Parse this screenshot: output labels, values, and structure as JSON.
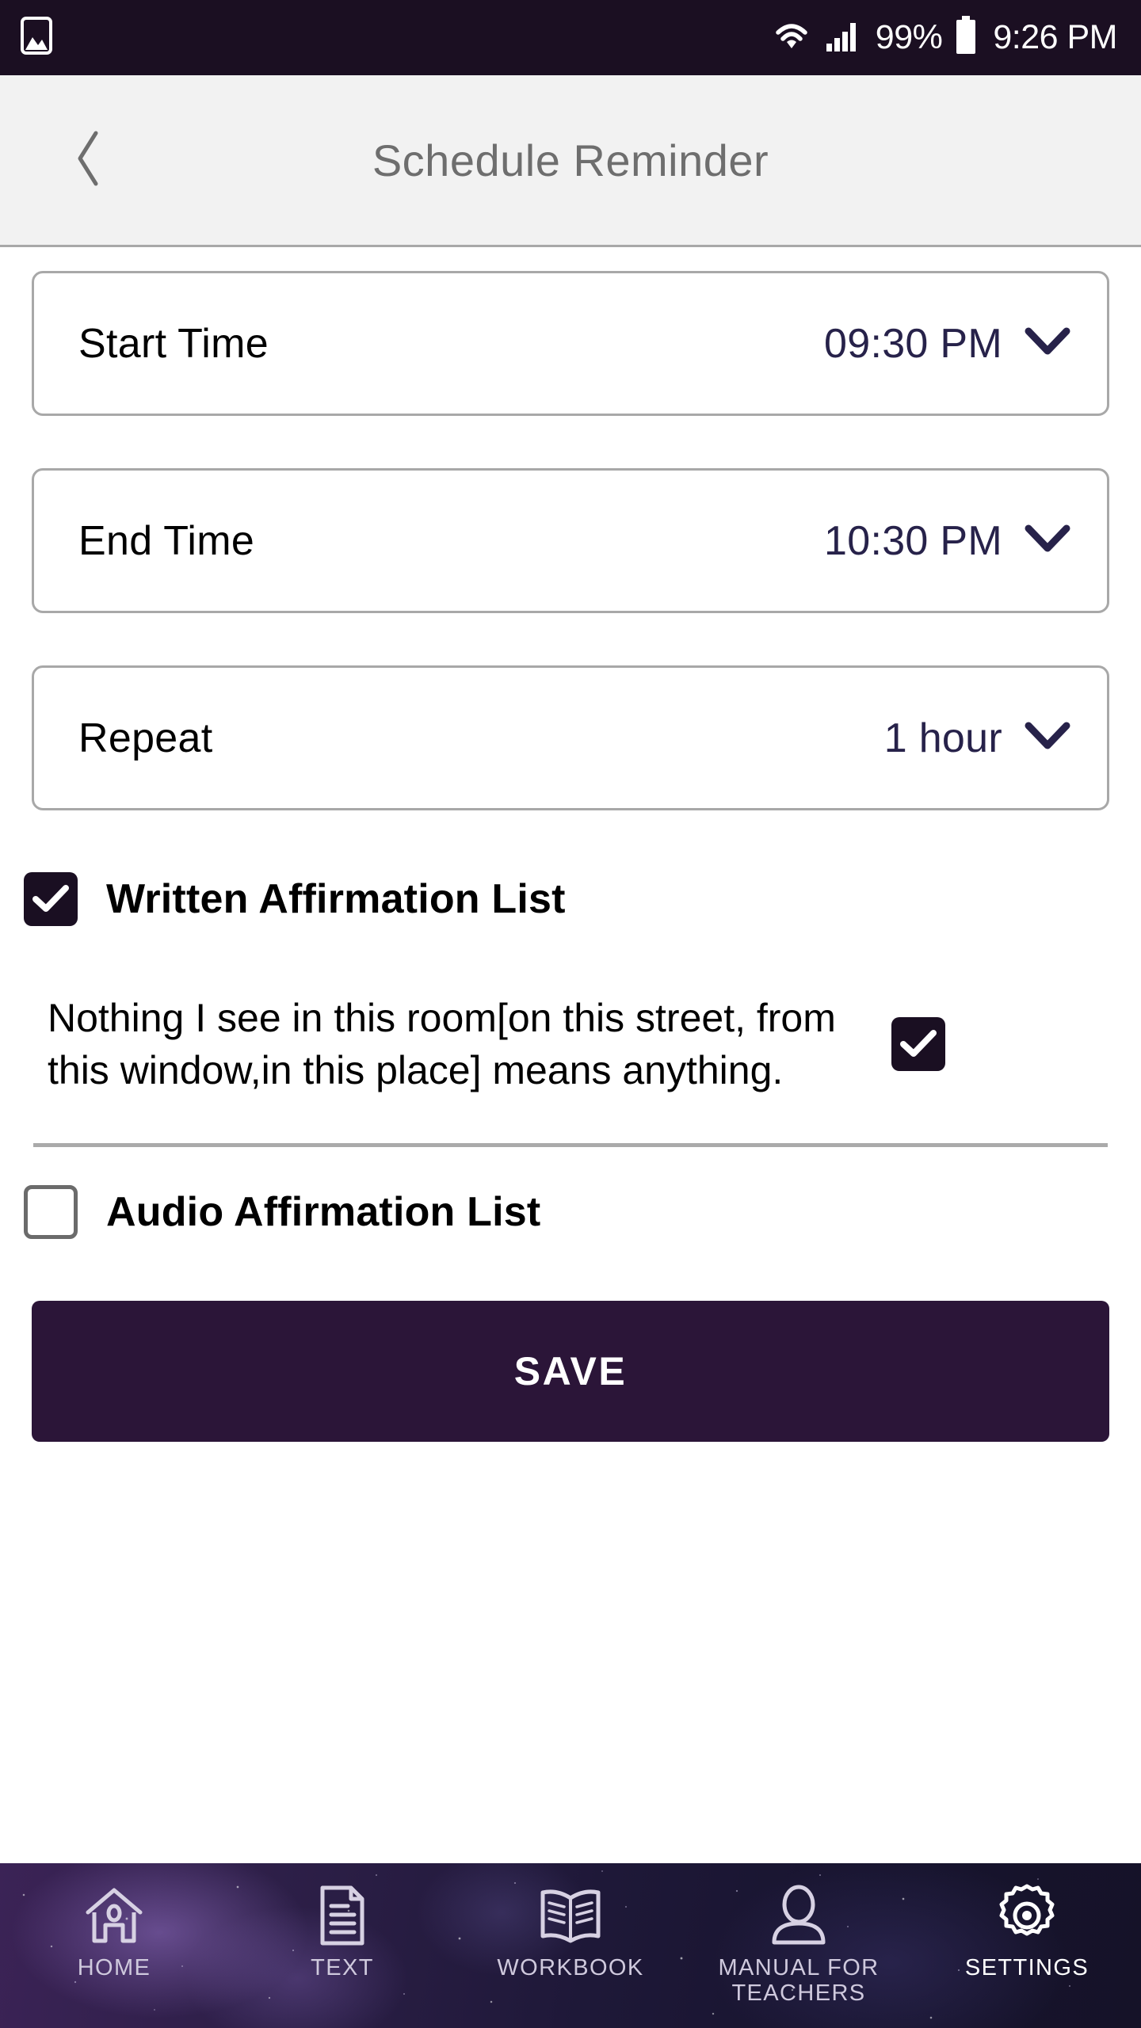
{
  "status_bar": {
    "left_icon": "image-icon",
    "wifi_icon": "wifi-icon",
    "signal_icon": "cellular-signal-icon",
    "battery_percent": "99%",
    "battery_icon": "battery-full-icon",
    "time": "9:26 PM",
    "background_color": "#1b0f22",
    "text_color": "#ffffff"
  },
  "header": {
    "back_icon": "chevron-left-icon",
    "title": "Schedule Reminder",
    "background_color": "#f2f2f2",
    "title_color": "#6e6e6e"
  },
  "form": {
    "fields": [
      {
        "label": "Start Time",
        "value": "09:30 PM",
        "icon": "chevron-down-icon"
      },
      {
        "label": "End Time",
        "value": "10:30 PM",
        "icon": "chevron-down-icon"
      },
      {
        "label": "Repeat",
        "value": "1 hour",
        "icon": "chevron-down-icon"
      }
    ]
  },
  "written_section": {
    "checkbox_label": "Written Affirmation List",
    "checked": true,
    "items": [
      {
        "text": "Nothing I see in this room[on this street, from this window,in this place] means anything.",
        "checked": true
      }
    ]
  },
  "audio_section": {
    "checkbox_label": "Audio Affirmation List",
    "checked": false
  },
  "save_button": {
    "label": "SAVE",
    "background_color": "#2b1538",
    "text_color": "#ffffff"
  },
  "bottom_nav": {
    "items": [
      {
        "label": "HOME",
        "icon": "home-icon",
        "active": false
      },
      {
        "label": "TEXT",
        "icon": "document-icon",
        "active": false
      },
      {
        "label": "WORKBOOK",
        "icon": "open-book-icon",
        "active": false
      },
      {
        "label": "MANUAL FOR\nTEACHERS",
        "icon": "person-icon",
        "active": false
      },
      {
        "label": "SETTINGS",
        "icon": "gear-icon",
        "active": true
      }
    ]
  },
  "theme": {
    "accent_dark": "#2b1538",
    "checkbox_fill": "#1a0f22",
    "value_text": "#27224a",
    "border_gray": "#a8a8a8"
  }
}
